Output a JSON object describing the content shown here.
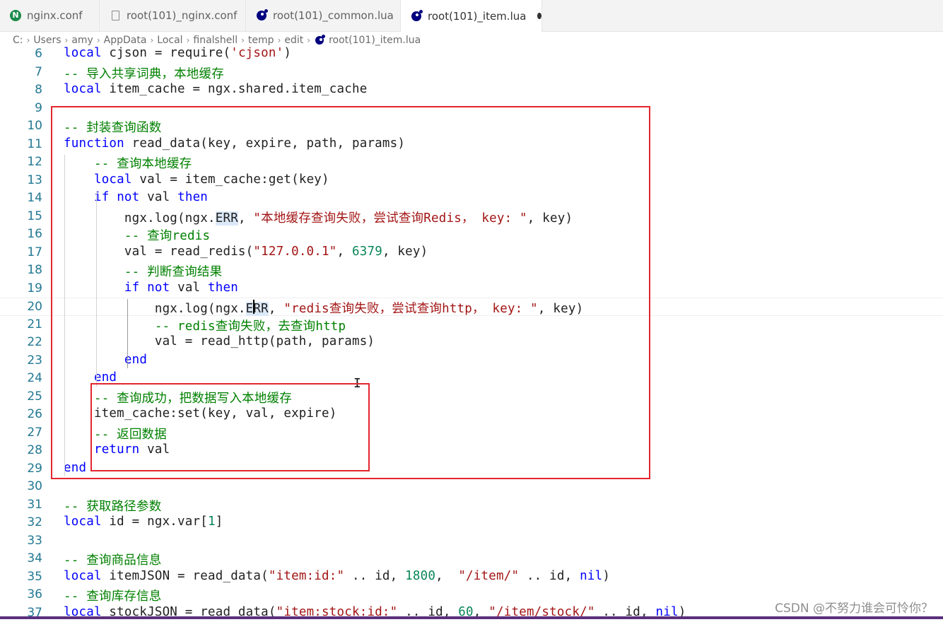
{
  "tabs": [
    {
      "label": "nginx.conf",
      "icon": "nginx-icon",
      "active": false
    },
    {
      "label": "root(101)_nginx.conf",
      "icon": "file-icon",
      "active": false
    },
    {
      "label": "root(101)_common.lua",
      "icon": "lua-icon",
      "active": false
    },
    {
      "label": "root(101)_item.lua",
      "icon": "lua-icon",
      "active": true,
      "modified": true
    }
  ],
  "breadcrumb": [
    "C:",
    "Users",
    "amy",
    "AppData",
    "Local",
    "finalshell",
    "temp",
    "edit",
    "root(101)_item.lua"
  ],
  "code_lines": [
    {
      "n": "6",
      "text": "local cjson = require('cjson')"
    },
    {
      "n": "7",
      "text": "-- 导入共享词典，本地缓存"
    },
    {
      "n": "8",
      "text": "local item_cache = ngx.shared.item_cache"
    },
    {
      "n": "9",
      "text": ""
    },
    {
      "n": "10",
      "text": "-- 封装查询函数"
    },
    {
      "n": "11",
      "text": "function read_data(key, expire, path, params)"
    },
    {
      "n": "12",
      "text": "    -- 查询本地缓存"
    },
    {
      "n": "13",
      "text": "    local val = item_cache:get(key)"
    },
    {
      "n": "14",
      "text": "    if not val then"
    },
    {
      "n": "15",
      "text": "        ngx.log(ngx.ERR, \"本地缓存查询失败，尝试查询Redis， key: \", key)"
    },
    {
      "n": "16",
      "text": "        -- 查询redis"
    },
    {
      "n": "17",
      "text": "        val = read_redis(\"127.0.0.1\", 6379, key)"
    },
    {
      "n": "18",
      "text": "        -- 判断查询结果"
    },
    {
      "n": "19",
      "text": "        if not val then"
    },
    {
      "n": "20",
      "text": "            ngx.log(ngx.ERR, \"redis查询失败，尝试查询http， key: \", key)"
    },
    {
      "n": "21",
      "text": "            -- redis查询失败，去查询http"
    },
    {
      "n": "22",
      "text": "            val = read_http(path, params)"
    },
    {
      "n": "23",
      "text": "        end"
    },
    {
      "n": "24",
      "text": "    end"
    },
    {
      "n": "25",
      "text": "    -- 查询成功，把数据写入本地缓存"
    },
    {
      "n": "26",
      "text": "    item_cache:set(key, val, expire)"
    },
    {
      "n": "27",
      "text": "    -- 返回数据"
    },
    {
      "n": "28",
      "text": "    return val"
    },
    {
      "n": "29",
      "text": "end"
    },
    {
      "n": "30",
      "text": ""
    },
    {
      "n": "31",
      "text": "-- 获取路径参数"
    },
    {
      "n": "32",
      "text": "local id = ngx.var[1]"
    },
    {
      "n": "33",
      "text": ""
    },
    {
      "n": "34",
      "text": "-- 查询商品信息"
    },
    {
      "n": "35",
      "text": "local itemJSON = read_data(\"item:id:\" .. id, 1800,  \"/item/\" .. id, nil)"
    },
    {
      "n": "36",
      "text": "-- 查询库存信息"
    },
    {
      "n": "37",
      "text": "local stockJSON = read_data(\"item:stock:id:\" .. id, 60, \"/item/stock/\" .. id, nil)"
    }
  ],
  "watermark": "CSDN @不努力谁会可怜你？",
  "colors": {
    "keyword": "#0000ff",
    "comment": "#008000",
    "string": "#a31515",
    "number": "#098658",
    "line_number": "#237893",
    "annotation_box": "#e3262e"
  }
}
